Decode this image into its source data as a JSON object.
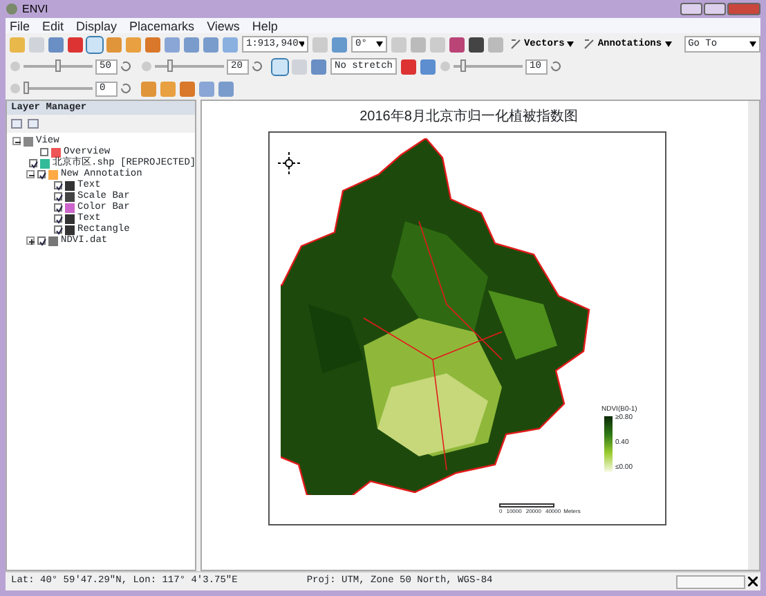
{
  "window": {
    "title": "ENVI"
  },
  "menu": [
    "File",
    "Edit",
    "Display",
    "Placemarks",
    "Views",
    "Help"
  ],
  "toolbar1": [
    {
      "kind": "icon"
    },
    {
      "kind": "icon"
    },
    {
      "kind": "icon"
    },
    {
      "kind": "icon"
    },
    {
      "kind": "icon",
      "selected": true
    },
    {
      "kind": "icon"
    },
    {
      "kind": "icon"
    },
    {
      "kind": "icon"
    },
    {
      "kind": "icon"
    },
    {
      "kind": "icon"
    },
    {
      "kind": "icon"
    },
    {
      "kind": "icon"
    },
    {
      "kind": "combo",
      "value": "1:913,940",
      "wide": false
    },
    {
      "kind": "icon"
    },
    {
      "kind": "icon"
    },
    {
      "kind": "combo",
      "value": "0°",
      "wide": false
    },
    {
      "kind": "icon"
    },
    {
      "kind": "icon"
    },
    {
      "kind": "icon"
    },
    {
      "kind": "icon"
    },
    {
      "kind": "icon"
    },
    {
      "kind": "icon"
    },
    {
      "kind": "menu",
      "label": "Vectors"
    },
    {
      "kind": "menu",
      "label": "Annotations"
    },
    {
      "kind": "combo",
      "value": "Go To",
      "wide": true
    }
  ],
  "toolbar2": [
    {
      "kind": "slider",
      "level": 0.5,
      "value": "50"
    },
    {
      "kind": "slider",
      "level": 0.2,
      "value": "20"
    },
    {
      "kind": "icon",
      "selected": true
    },
    {
      "kind": "icon"
    },
    {
      "kind": "icon"
    },
    {
      "kind": "combo",
      "value": "No stretch",
      "wide": false
    },
    {
      "kind": "icon"
    },
    {
      "kind": "icon"
    },
    {
      "kind": "slider",
      "level": 0.1,
      "value": "10"
    }
  ],
  "toolbar3": [
    {
      "kind": "slider",
      "level": 0.0,
      "value": "0"
    },
    {
      "kind": "icon"
    },
    {
      "kind": "icon"
    },
    {
      "kind": "icon"
    },
    {
      "kind": "icon"
    },
    {
      "kind": "icon"
    }
  ],
  "layer_manager": {
    "title": "Layer Manager",
    "tree": [
      {
        "label": "View",
        "expanded": true,
        "children": [
          {
            "label": "Overview",
            "checked": false
          },
          {
            "label": "北京市区.shp [REPROJECTED]",
            "checked": true
          },
          {
            "label": "New Annotation",
            "checked": true,
            "expanded": true,
            "children": [
              {
                "label": "Text",
                "checked": true
              },
              {
                "label": "Scale Bar",
                "checked": true
              },
              {
                "label": "Color Bar",
                "checked": true
              },
              {
                "label": "Text",
                "checked": true
              },
              {
                "label": "Rectangle",
                "checked": true
              }
            ]
          },
          {
            "label": "NDVI.dat",
            "checked": true,
            "expanded": false
          }
        ]
      }
    ]
  },
  "map": {
    "title": "2016年8月北京市归一化植被指数图",
    "legend": {
      "title": "NDVI(B0-1)",
      "labels": [
        "≥0.80",
        "0.40",
        "≤0.00"
      ]
    },
    "scale_bar": {
      "labels": [
        "0",
        "10000",
        "20000",
        "40000"
      ],
      "unit": "Meters"
    }
  },
  "status_bar": [
    "Lat: 40° 59'47.29\"N, Lon: 117° 4'3.75\"E",
    "Proj: UTM, Zone 50 North, WGS-84"
  ]
}
